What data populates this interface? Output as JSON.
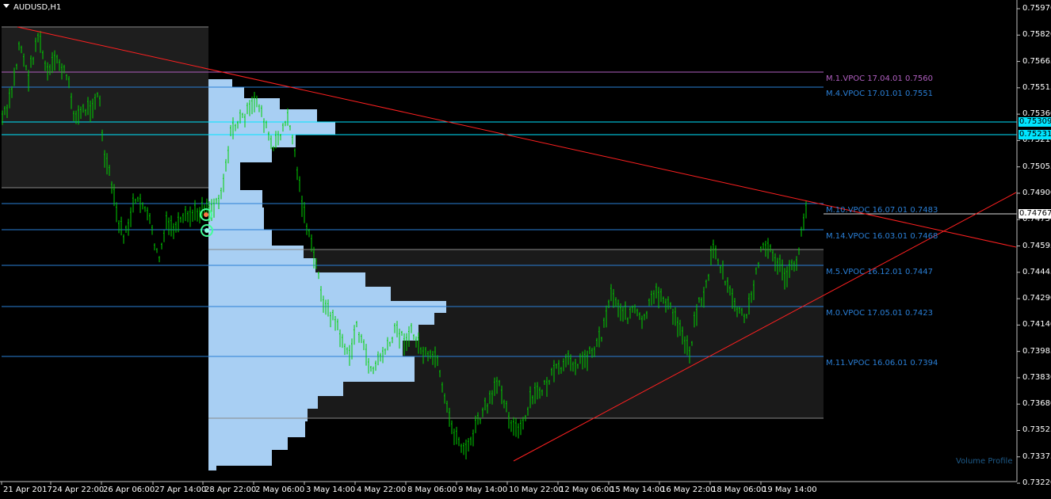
{
  "window": {
    "symbol_timeframe": "AUDUSD,H1"
  },
  "indicator_name": "Volume Profile",
  "colors": {
    "candle": "#00d000",
    "trendline": "#ff2020",
    "vpoc": "#2a7fd6",
    "profile_bar": "#a8cff3",
    "highlight": "#00e5ff",
    "month_level": "#b05fc0"
  },
  "price_axis": {
    "ticks": [
      "0.75970",
      "0.75820",
      "0.75665",
      "0.75515",
      "0.75360",
      "0.75210",
      "0.75055",
      "0.74900",
      "0.74750",
      "0.74595",
      "0.74445",
      "0.74290",
      "0.74140",
      "0.73985",
      "0.73830",
      "0.73680",
      "0.73525",
      "0.73375",
      "0.73220"
    ],
    "current_tags": [
      {
        "value": "0.75309",
        "color": "#00e5ff"
      },
      {
        "value": "0.75231",
        "color": "#00e5ff"
      },
      {
        "value": "0.74767",
        "color": "#ffffff"
      }
    ]
  },
  "time_axis": {
    "labels": [
      "21 Apr 2017",
      "24 Apr 22:00",
      "26 Apr 06:00",
      "27 Apr 14:00",
      "28 Apr 22:00",
      "2 May 06:00",
      "3 May 14:00",
      "4 May 22:00",
      "8 May 06:00",
      "9 May 14:00",
      "10 May 22:00",
      "12 May 06:00",
      "15 May 14:00",
      "16 May 22:00",
      "18 May 06:00",
      "19 May 14:00"
    ]
  },
  "vpoc_levels": [
    {
      "label": "M.1.VPOC 17.04.01 0.7560",
      "color": "#b05fc0"
    },
    {
      "label": "M.4.VPOC 17.01.01 0.7551",
      "color": "#2a7fd6"
    },
    {
      "label": "M.10.VPOC 16.07.01 0.7483",
      "color": "#2a7fd6"
    },
    {
      "label": "M.14.VPOC 16.03.01 0.7468",
      "color": "#2a7fd6"
    },
    {
      "label": "M.5.VPOC 16.12.01 0.7447",
      "color": "#2a7fd6"
    },
    {
      "label": "M.0.VPOC 17.05.01 0.7423",
      "color": "#2a7fd6"
    },
    {
      "label": "M.11.VPOC 16.06.01 0.7394",
      "color": "#2a7fd6"
    }
  ]
}
